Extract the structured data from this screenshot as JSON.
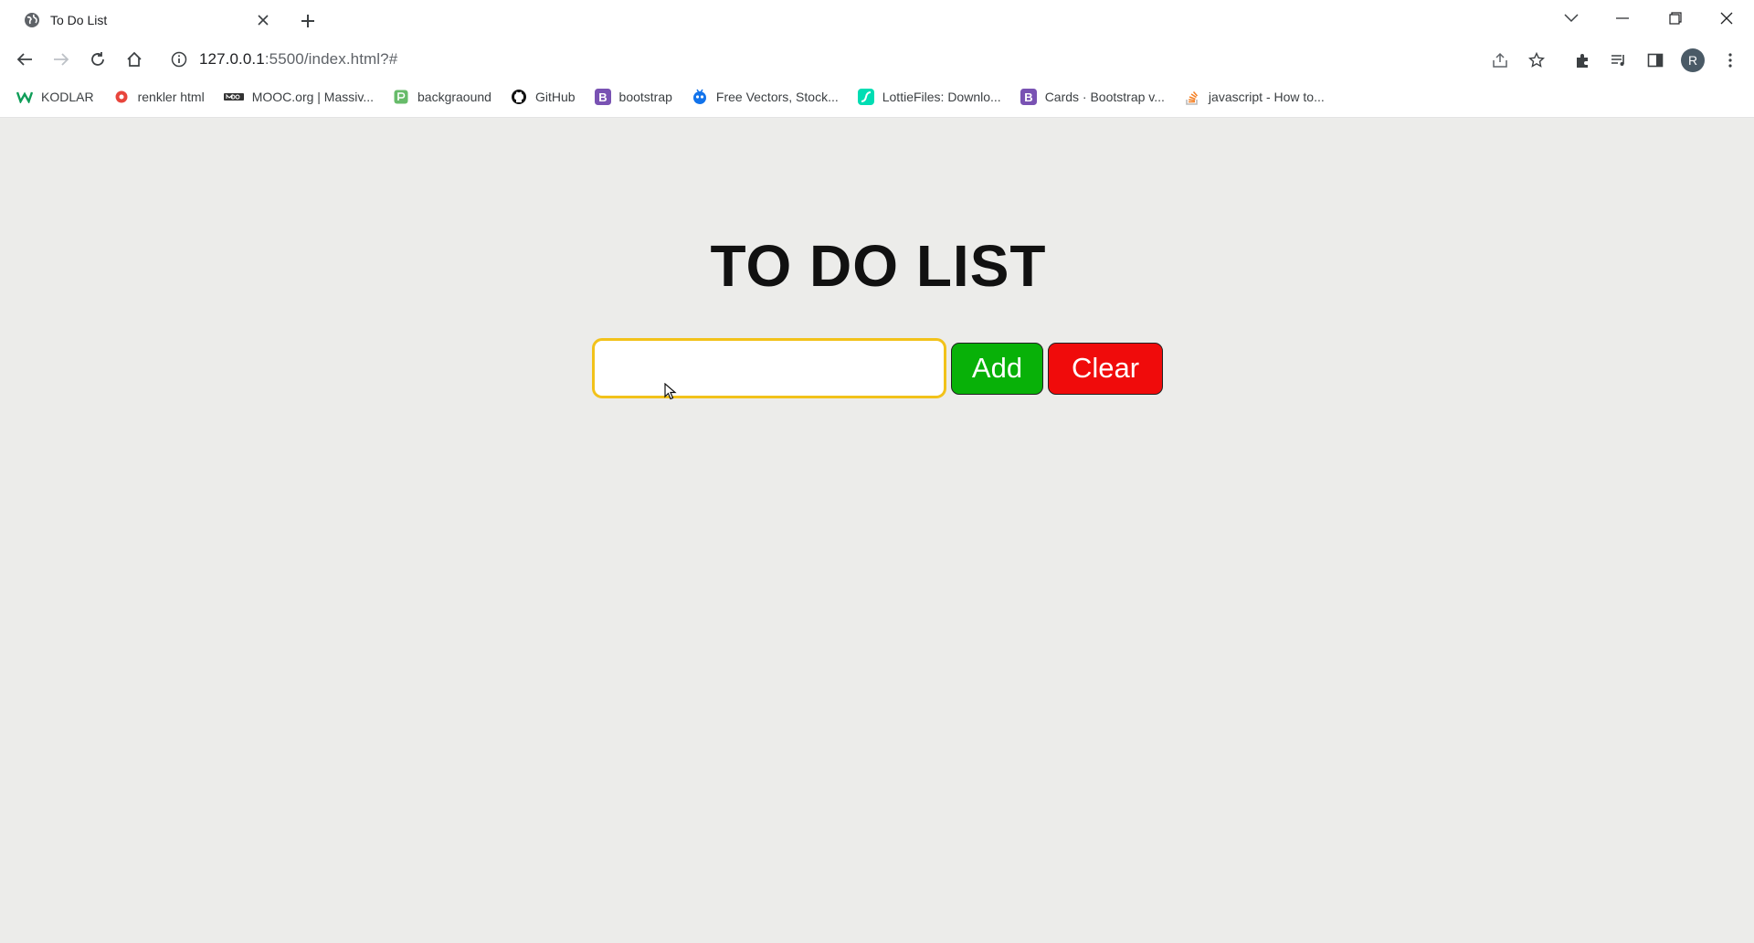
{
  "browser": {
    "tab": {
      "title": "To Do List"
    },
    "url": {
      "host": "127.0.0.1",
      "rest": ":5500/index.html?#"
    },
    "profile_initial": "R",
    "bookmarks": [
      {
        "label": "KODLAR",
        "icon": "w-logo-icon",
        "color": "#0f9d58"
      },
      {
        "label": "renkler html",
        "icon": "circle-logo-icon",
        "color": "#e8453c"
      },
      {
        "label": "MOOC.org | Massiv...",
        "icon": "mooc-logo-icon",
        "color": "#333333"
      },
      {
        "label": "backgraound",
        "icon": "green-square-icon",
        "color": "#4caf50"
      },
      {
        "label": "GitHub",
        "icon": "github-icon",
        "color": "#111111"
      },
      {
        "label": "bootstrap",
        "icon": "bootstrap-icon",
        "color": "#7952b3"
      },
      {
        "label": "Free Vectors, Stock...",
        "icon": "freepik-icon",
        "color": "#1273eb"
      },
      {
        "label": "LottieFiles: Downlo...",
        "icon": "lottie-icon",
        "color": "#00ddb3"
      },
      {
        "label": "Cards · Bootstrap v...",
        "icon": "bootstrap-icon",
        "color": "#7952b3"
      },
      {
        "label": "javascript - How to...",
        "icon": "stackoverflow-icon",
        "color": "#f48024"
      }
    ]
  },
  "app": {
    "heading": "TO DO LIST",
    "input": {
      "value": "",
      "placeholder": ""
    },
    "add_label": "Add",
    "clear_label": "Clear"
  },
  "colors": {
    "page_bg": "#ececea",
    "input_border": "#f2c21a",
    "add_bg": "#08b108",
    "clear_bg": "#f00b0b"
  }
}
